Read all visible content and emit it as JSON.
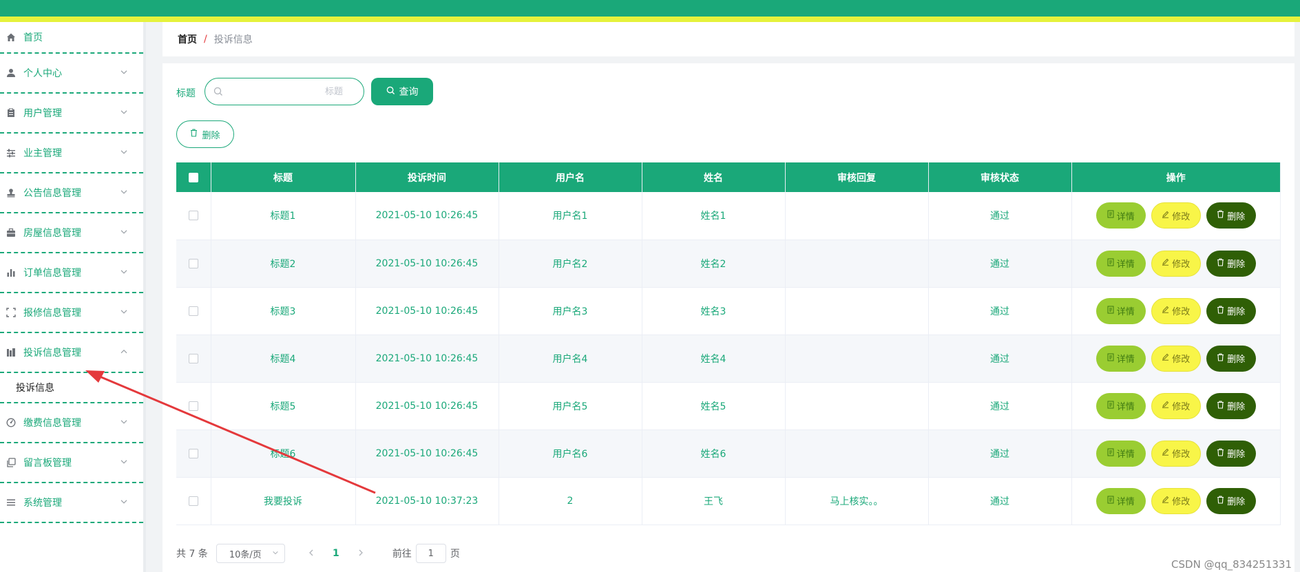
{
  "menu": {
    "items": [
      {
        "label": "首页",
        "icon": "home-icon"
      },
      {
        "label": "个人中心",
        "icon": "user-icon"
      },
      {
        "label": "用户管理",
        "icon": "clipboard-icon"
      },
      {
        "label": "业主管理",
        "icon": "sliders-icon"
      },
      {
        "label": "公告信息管理",
        "icon": "stamp-icon"
      },
      {
        "label": "房屋信息管理",
        "icon": "briefcase-icon"
      },
      {
        "label": "订单信息管理",
        "icon": "bar-chart-icon"
      },
      {
        "label": "报修信息管理",
        "icon": "scan-icon"
      },
      {
        "label": "投诉信息管理",
        "icon": "building-icon"
      },
      {
        "label": "缴费信息管理",
        "icon": "gauge-icon"
      },
      {
        "label": "留言板管理",
        "icon": "copy-icon"
      },
      {
        "label": "系统管理",
        "icon": "list-icon"
      }
    ],
    "submenu_label": "投诉信息"
  },
  "breadcrumb": {
    "home": "首页",
    "sep": "/",
    "current": "投诉信息"
  },
  "search": {
    "label": "标题",
    "placeholder": "标题",
    "button": "查询"
  },
  "actions": {
    "delete_label": "删除"
  },
  "table": {
    "columns": [
      "标题",
      "投诉时间",
      "用户名",
      "姓名",
      "审核回复",
      "审核状态",
      "操作"
    ],
    "rows": [
      {
        "title": "标题1",
        "time": "2021-05-10 10:26:45",
        "username": "用户名1",
        "name": "姓名1",
        "reply": "",
        "status": "通过"
      },
      {
        "title": "标题2",
        "time": "2021-05-10 10:26:45",
        "username": "用户名2",
        "name": "姓名2",
        "reply": "",
        "status": "通过"
      },
      {
        "title": "标题3",
        "time": "2021-05-10 10:26:45",
        "username": "用户名3",
        "name": "姓名3",
        "reply": "",
        "status": "通过"
      },
      {
        "title": "标题4",
        "time": "2021-05-10 10:26:45",
        "username": "用户名4",
        "name": "姓名4",
        "reply": "",
        "status": "通过"
      },
      {
        "title": "标题5",
        "time": "2021-05-10 10:26:45",
        "username": "用户名5",
        "name": "姓名5",
        "reply": "",
        "status": "通过"
      },
      {
        "title": "标题6",
        "time": "2021-05-10 10:26:45",
        "username": "用户名6",
        "name": "姓名6",
        "reply": "",
        "status": "通过"
      },
      {
        "title": "我要投诉",
        "time": "2021-05-10 10:37:23",
        "username": "2",
        "name": "王飞",
        "reply": "马上核实。。",
        "status": "通过"
      }
    ],
    "row_buttons": {
      "detail": "详情",
      "edit": "修改",
      "delete": "删除"
    }
  },
  "pagination": {
    "total": "共 7 条",
    "page_size": "10条/页",
    "current_page": "1",
    "goto_label": "前往",
    "goto_value": "1",
    "page_suffix": "页"
  },
  "watermark": "CSDN @qq_834251331",
  "colors": {
    "primary": "#1aa879",
    "accent_yellow": "#e5f23c",
    "detail_btn": "#9acd32",
    "edit_btn": "#f8f548",
    "delete_btn": "#2f5f06",
    "annotation_arrow": "#e4393c"
  }
}
